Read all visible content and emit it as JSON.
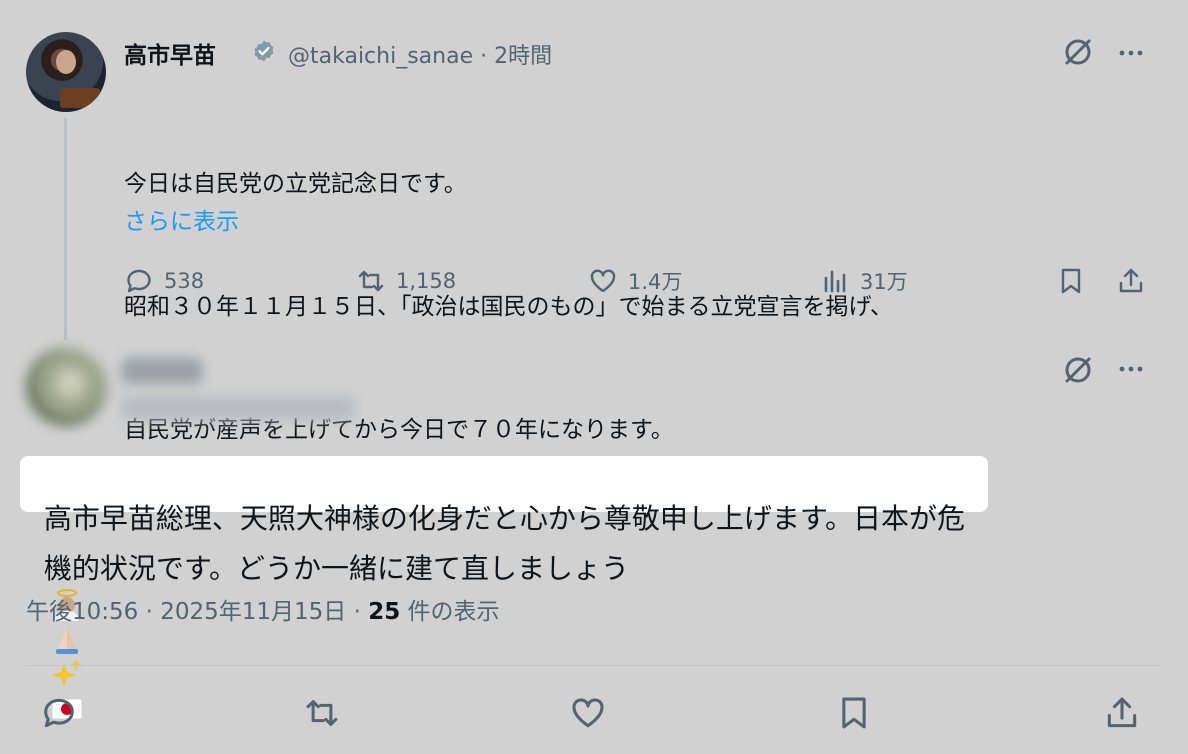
{
  "post": {
    "name": "高市早苗",
    "handle": "@takaichi_sanae · 2時間",
    "lines": [
      "今日は自民党の立党記念日です。",
      "昭和３０年１１月１５日、「政治は国民のもの」で始まる立党宣言を掲げ、",
      "自民党が産声を上げてから今日で７０年になります。"
    ],
    "show_more": "さらに表示",
    "stats": {
      "replies": "538",
      "reposts": "1,158",
      "likes": "1.4万",
      "views": "31万"
    }
  },
  "reply": {
    "line1_highlighted": "高市早苗総理、天照大神様の化身だと心から尊敬申し上げます。",
    "line1_rest": "日本が危",
    "line2": "機的状況です。どうか一緒に建て直しましょう",
    "emojis": [
      "angel-emoji",
      "folded-hands-emoji",
      "sparkles-emoji",
      "japan-flag-emoji"
    ],
    "meta_time": "午後10:56 · 2025年11月15日 · ",
    "meta_views_count": "25",
    "meta_views_label": " 件の表示"
  },
  "colors": {
    "background": "#d1d1d1",
    "link": "#1d9bf0",
    "verified": "#829aab",
    "muted": "#536471"
  }
}
